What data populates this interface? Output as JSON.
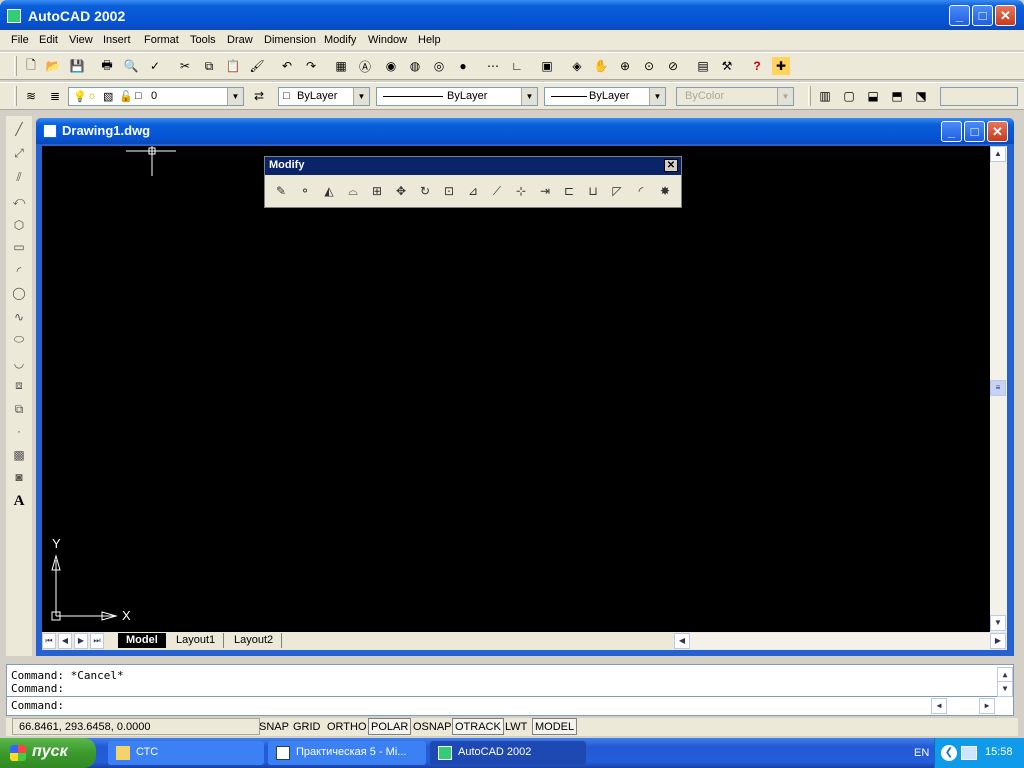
{
  "app": {
    "title": "AutoCAD 2002",
    "window_buttons": {
      "minimize": "_",
      "maximize": "□",
      "close": "✕"
    }
  },
  "menu": [
    "File",
    "Edit",
    "View",
    "Insert",
    "Format",
    "Tools",
    "Draw",
    "Dimension",
    "Modify",
    "Window",
    "Help"
  ],
  "properties": {
    "layer_value": "0",
    "color_value": "ByLayer",
    "linetype_value": "ByLayer",
    "lineweight_value": "ByLayer",
    "plotstyle_value": "ByColor"
  },
  "document": {
    "title": "Drawing1.dwg",
    "ucs": {
      "x_label": "X",
      "y_label": "Y"
    },
    "tabs": [
      {
        "label": "Model",
        "active": true
      },
      {
        "label": "Layout1",
        "active": false
      },
      {
        "label": "Layout2",
        "active": false
      }
    ]
  },
  "modify_toolbar": {
    "title": "Modify",
    "close": "✕"
  },
  "command": {
    "lines": [
      "Command: *Cancel*",
      "Command:"
    ],
    "prompt": "Command:"
  },
  "status": {
    "coords": "66.8461, 293.6458, 0.0000",
    "toggles": [
      {
        "label": "SNAP",
        "on": false
      },
      {
        "label": "GRID",
        "on": false
      },
      {
        "label": "ORTHO",
        "on": false
      },
      {
        "label": "POLAR",
        "on": true
      },
      {
        "label": "OSNAP",
        "on": false
      },
      {
        "label": "OTRACK",
        "on": true
      },
      {
        "label": "LWT",
        "on": false
      },
      {
        "label": "MODEL",
        "on": true
      }
    ]
  },
  "taskbar": {
    "start": "пуск",
    "items": [
      {
        "label": "СТС",
        "active": false
      },
      {
        "label": "Практическая 5 - Mi...",
        "active": false
      },
      {
        "label": "AutoCAD 2002",
        "active": true
      }
    ],
    "language": "EN",
    "clock": "15:58"
  }
}
